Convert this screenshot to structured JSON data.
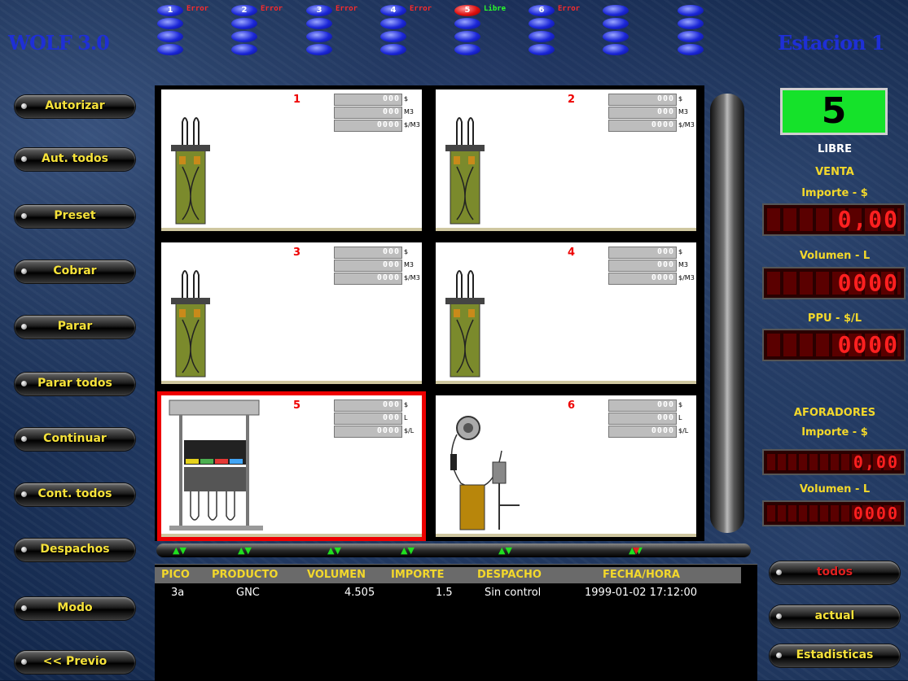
{
  "app": {
    "title": "WOLF 3.0",
    "station": "Estacion 1"
  },
  "status_leds": [
    {
      "num": "1",
      "text": "Error",
      "color": "#ff2a2a"
    },
    {
      "num": "2",
      "text": "Error",
      "color": "#ff2a2a"
    },
    {
      "num": "3",
      "text": "Error",
      "color": "#ff2a2a"
    },
    {
      "num": "4",
      "text": "Error",
      "color": "#ff2a2a"
    },
    {
      "num": "5",
      "text": "Libre",
      "color": "#2aff2a"
    },
    {
      "num": "6",
      "text": "Error",
      "color": "#ff2a2a"
    }
  ],
  "left_buttons": [
    "Autorizar",
    "Aut. todos",
    "Preset",
    "Cobrar",
    "Parar",
    "Parar todos",
    "Continuar",
    "Cont. todos",
    "Despachos",
    "Modo",
    "<< Previo"
  ],
  "pumps": [
    {
      "num": "1",
      "units": [
        "$",
        "M3",
        "$/M3"
      ]
    },
    {
      "num": "2",
      "units": [
        "$",
        "M3",
        "$/M3"
      ]
    },
    {
      "num": "3",
      "units": [
        "$",
        "M3",
        "$/M3"
      ]
    },
    {
      "num": "4",
      "units": [
        "$",
        "M3",
        "$/M3"
      ]
    },
    {
      "num": "5",
      "units": [
        "$",
        "L",
        "$/L"
      ]
    },
    {
      "num": "6",
      "units": [
        "$",
        "L",
        "$/L"
      ]
    }
  ],
  "table": {
    "headers": [
      "PICO",
      "PRODUCTO",
      "VOLUMEN",
      "IMPORTE",
      "DESPACHO",
      "FECHA/HORA"
    ],
    "rows": [
      [
        "3a",
        "GNC",
        "4.505",
        "1.5",
        "Sin control",
        "1999-01-02 17:12:00"
      ]
    ]
  },
  "right_panel": {
    "selected_pump": "5",
    "state": "LIBRE",
    "venta": "VENTA",
    "importe_label": "Importe - $",
    "importe_value": "0,00",
    "volumen_label": "Volumen - L",
    "volumen_value": "0000",
    "ppu_label": "PPU - $/L",
    "ppu_value": "0000",
    "aforadores": "AFORADORES",
    "af_importe_label": "Importe - $",
    "af_importe_value": "0,00",
    "af_volumen_label": "Volumen - L",
    "af_volumen_value": "0000"
  },
  "right_buttons": [
    "todos",
    "actual",
    "Estadisticas"
  ],
  "colors": {
    "accent_yellow": "#f6e23a",
    "accent_green": "#15e22a",
    "alert_red": "#ee0000"
  }
}
